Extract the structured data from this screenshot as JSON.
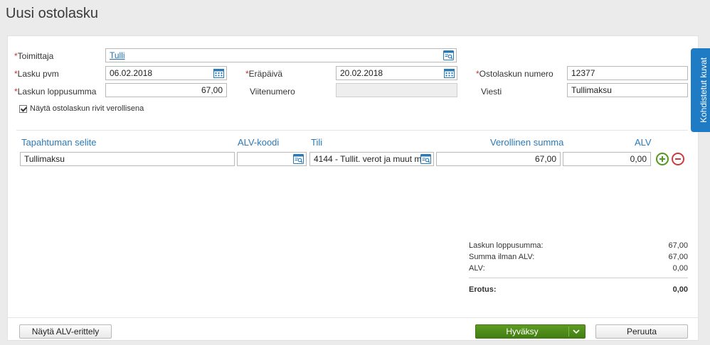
{
  "page": {
    "title": "Uusi ostolasku"
  },
  "side_tab": {
    "label": "Kohdistetut kuvat"
  },
  "form": {
    "required_mark": "*",
    "supplier": {
      "label": "Toimittaja",
      "value": "Tulli"
    },
    "invoice_date": {
      "label": "Lasku pvm",
      "value": "06.02.2018"
    },
    "due_date": {
      "label": "Eräpäivä",
      "value": "20.02.2018"
    },
    "invoice_number": {
      "label": "Ostolaskun numero",
      "value": "12377"
    },
    "total": {
      "label": "Laskun loppusumma",
      "value": "67,00"
    },
    "reference": {
      "label": "Viitenumero",
      "value": ""
    },
    "message": {
      "label": "Viesti",
      "value": "Tullimaksu"
    },
    "show_taxed": {
      "label": "Näytä ostolaskun rivit verollisena",
      "checked": true
    }
  },
  "rows": {
    "headers": {
      "description": "Tapahtuman selite",
      "vat_code": "ALV-koodi",
      "account": "Tili",
      "taxed_amount": "Verollinen summa",
      "vat": "ALV"
    },
    "items": [
      {
        "description": "Tullimaksu",
        "vat_code": "",
        "account": "4144 - Tullit. verot ja muut m",
        "taxed_amount": "67,00",
        "vat": "0,00"
      }
    ]
  },
  "summary": {
    "total_label": "Laskun loppusumma:",
    "total_value": "67,00",
    "net_label": "Summa ilman ALV:",
    "net_value": "67,00",
    "vat_label": "ALV:",
    "vat_value": "0,00",
    "diff_label": "Erotus:",
    "diff_value": "0,00"
  },
  "footer": {
    "vat_breakdown_label": "Näytä ALV-erittely",
    "approve_label": "Hyväksy",
    "cancel_label": "Peruuta"
  },
  "colors": {
    "accent_blue": "#1f7bc4",
    "approve_green": "#4f8e1a",
    "required_red": "#c0392b",
    "header_blue": "#2a7ab8"
  }
}
